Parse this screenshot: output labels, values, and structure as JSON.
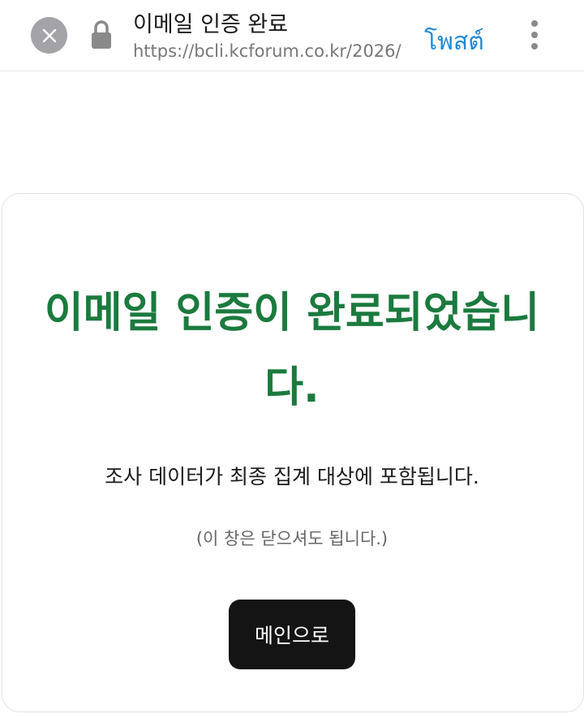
{
  "browser": {
    "page_title": "이메일 인증 완료",
    "url": "https://bcli.kcforum.co.kr/2026/",
    "translate_label": "โพสต์",
    "close_icon": "close-icon",
    "lock_icon": "lock-icon",
    "more_icon": "more-vertical-icon"
  },
  "main": {
    "heading": "이메일 인증이 완료되었습니다.",
    "subtext": "조사 데이터가 최종 집계 대상에 포함됩니다.",
    "note": "(이 창은 닫으셔도 됩니다.)",
    "button_label": "메인으로"
  },
  "colors": {
    "heading": "#1b7a3e",
    "button_bg": "#141414",
    "translate": "#1e88d8"
  }
}
